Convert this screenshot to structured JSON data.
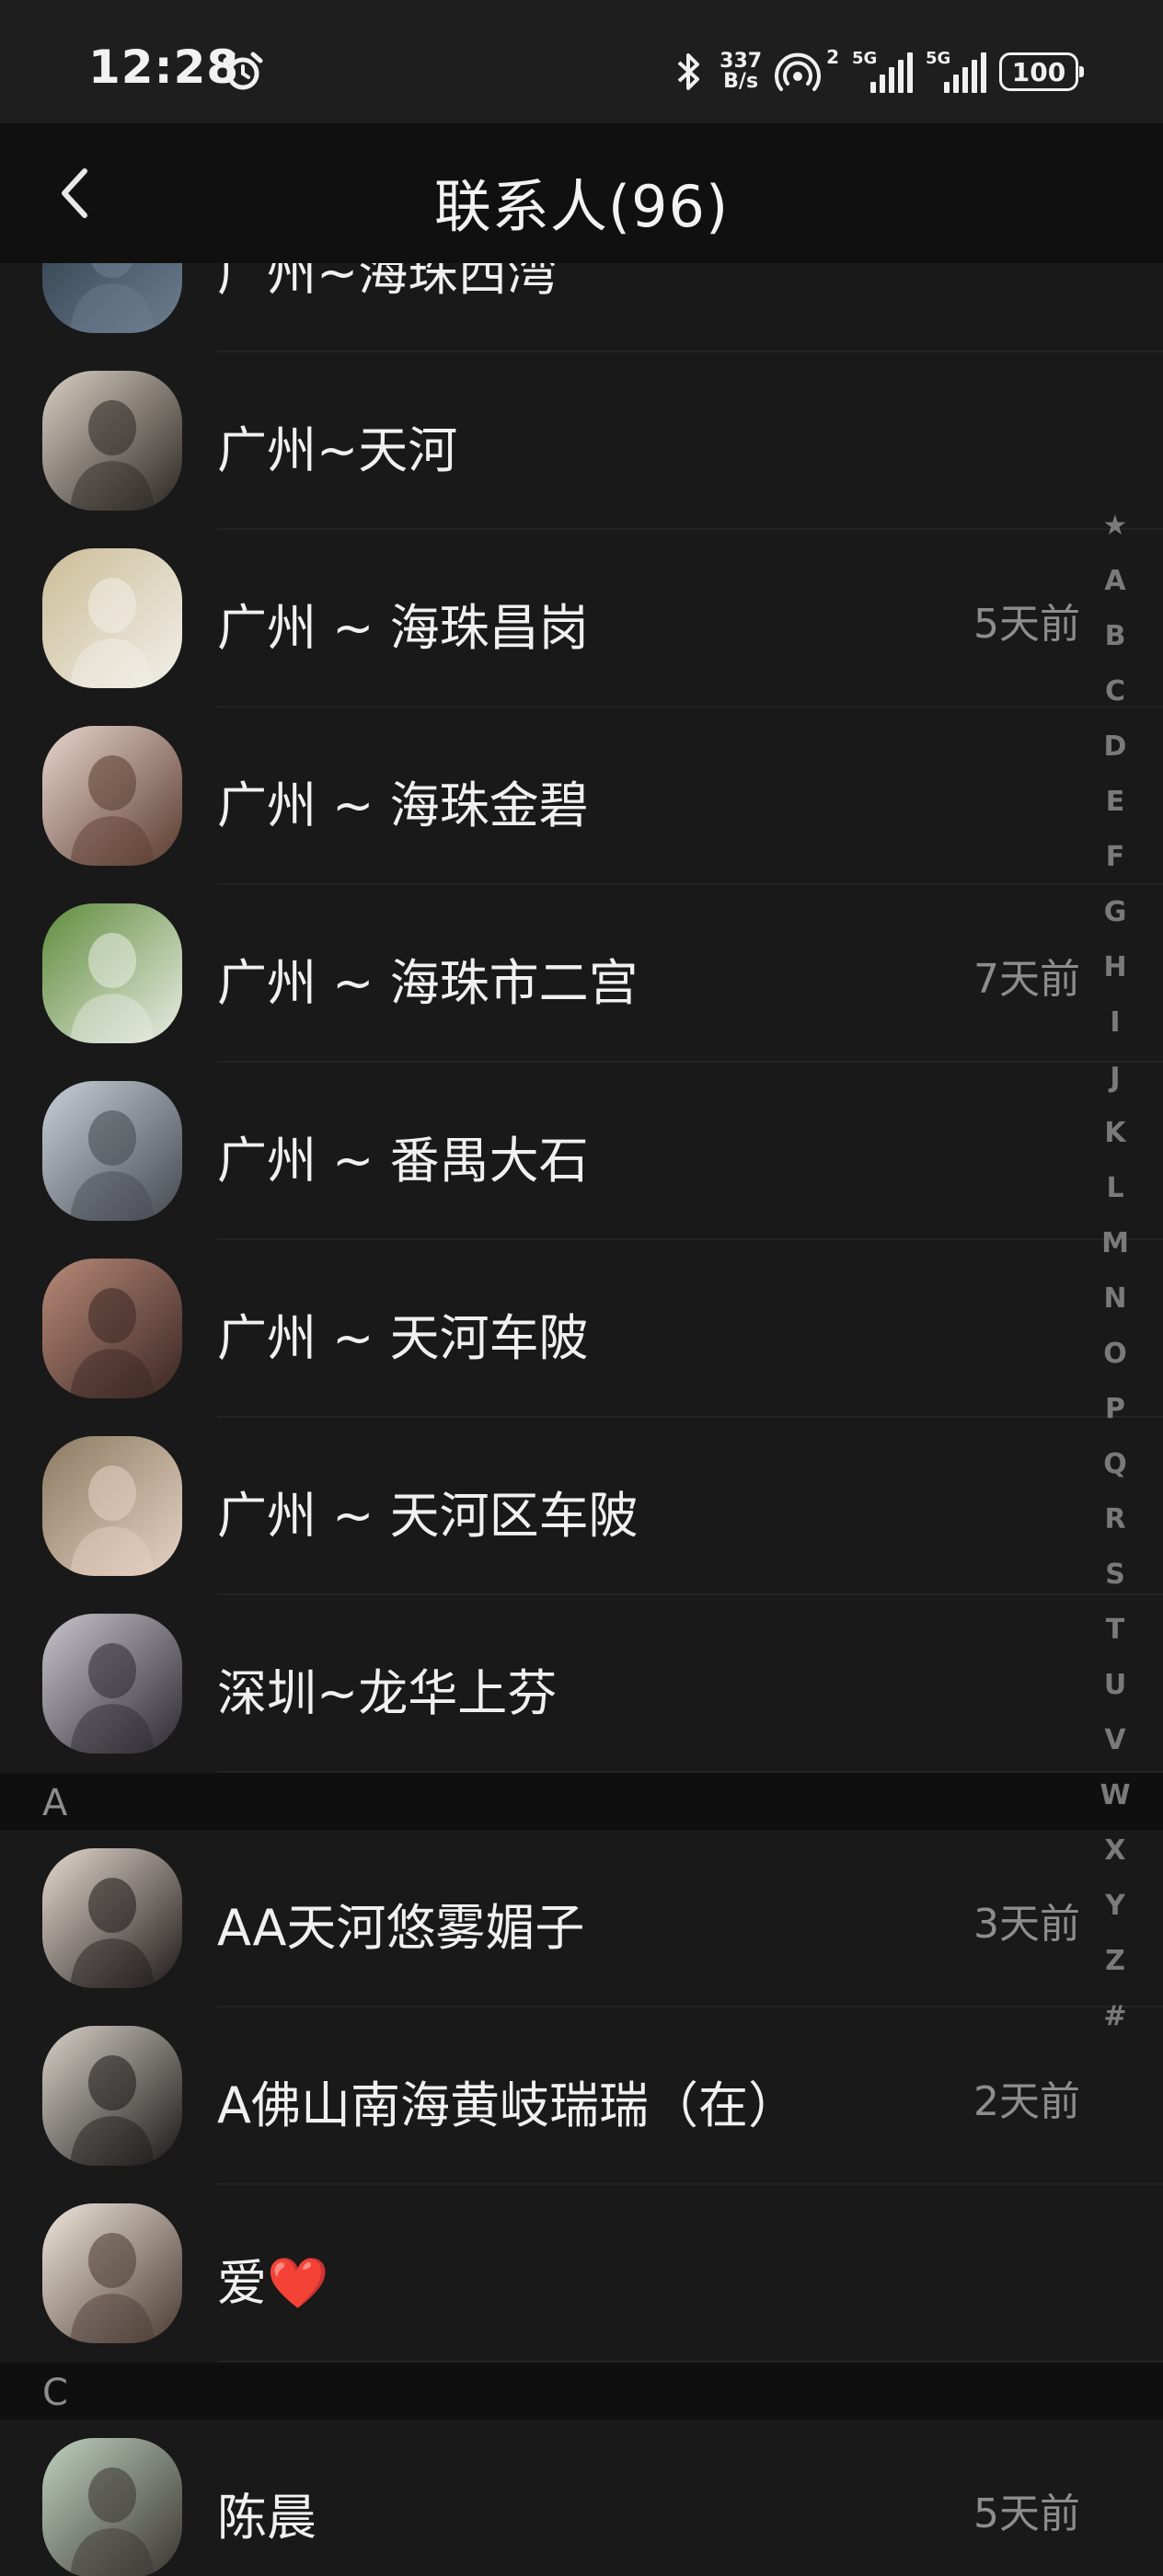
{
  "status_bar": {
    "time": "12:28",
    "net_speed_value": "337",
    "net_speed_unit": "B/s",
    "hotspot_sup": "2",
    "signal1_label": "5G",
    "signal2_label": "5G",
    "battery": "100"
  },
  "header": {
    "title": "联系人(96)",
    "back_icon": "chevron-left-icon"
  },
  "contacts": [
    {
      "name": "广州~海珠西湾",
      "time": "",
      "avatar_colors": [
        "#2c3a48",
        "#6d7f90"
      ]
    },
    {
      "name": "广州~天河",
      "time": "",
      "avatar_colors": [
        "#d9cfc3",
        "#2b2622"
      ]
    },
    {
      "name": "广州 ~ 海珠昌岗",
      "time": "5天前",
      "avatar_colors": [
        "#cbbd98",
        "#f2efe8"
      ]
    },
    {
      "name": "广州 ~ 海珠金碧",
      "time": "",
      "avatar_colors": [
        "#e8d6cc",
        "#5a3a2e"
      ]
    },
    {
      "name": "广州 ~ 海珠市二宫",
      "time": "7天前",
      "avatar_colors": [
        "#5f8c3c",
        "#e9ece4"
      ]
    },
    {
      "name": "广州 ~ 番禺大石",
      "time": "",
      "avatar_colors": [
        "#c9cfd8",
        "#44484f"
      ]
    },
    {
      "name": "广州 ~ 天河车陂",
      "time": "",
      "avatar_colors": [
        "#b88a78",
        "#3a2622"
      ]
    },
    {
      "name": "广州 ~ 天河区车陂",
      "time": "",
      "avatar_colors": [
        "#8b7a62",
        "#e6d2c4"
      ]
    },
    {
      "name": "深圳~龙华上芬",
      "time": "",
      "avatar_colors": [
        "#c8c6cc",
        "#2c2a30"
      ]
    }
  ],
  "section_a": {
    "letter": "A",
    "contacts": [
      {
        "name": "AA天河悠雾媚子",
        "time": "3天前",
        "avatar_colors": [
          "#e6dad0",
          "#1e1a1a"
        ]
      },
      {
        "name": "A佛山南海黄岐瑞瑞（在）",
        "time": "2天前",
        "avatar_colors": [
          "#d8d2c8",
          "#1a1818"
        ]
      },
      {
        "name": "爱❤️",
        "time": "",
        "avatar_colors": [
          "#efe6dc",
          "#4a3a32"
        ]
      }
    ]
  },
  "section_c": {
    "letter": "C",
    "contacts": [
      {
        "name": "陈晨",
        "time": "5天前",
        "avatar_colors": [
          "#bfd2c0",
          "#3a3430"
        ]
      }
    ]
  },
  "alphabet_index": [
    "★",
    "A",
    "B",
    "C",
    "D",
    "E",
    "F",
    "G",
    "H",
    "I",
    "J",
    "K",
    "L",
    "M",
    "N",
    "O",
    "P",
    "Q",
    "R",
    "S",
    "T",
    "U",
    "V",
    "W",
    "X",
    "Y",
    "Z",
    "#"
  ]
}
